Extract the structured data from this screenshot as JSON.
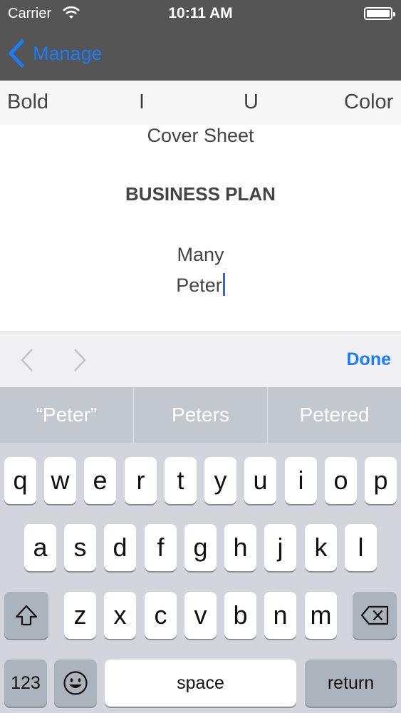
{
  "status_bar": {
    "carrier": "Carrier",
    "time": "10:11 AM"
  },
  "nav": {
    "back_label": "Manage"
  },
  "format_toolbar": {
    "bold": "Bold",
    "italic": "I",
    "underline": "U",
    "color": "Color"
  },
  "document": {
    "line1": "Cover Sheet",
    "line2": "BUSINESS PLAN",
    "line3": "Many",
    "line4": "Peter"
  },
  "accessory": {
    "done_label": "Done"
  },
  "suggestions": [
    "“Peter”",
    "Peters",
    "Petered"
  ],
  "keyboard": {
    "row1": [
      "q",
      "w",
      "e",
      "r",
      "t",
      "y",
      "u",
      "i",
      "o",
      "p"
    ],
    "row2": [
      "a",
      "s",
      "d",
      "f",
      "g",
      "h",
      "j",
      "k",
      "l"
    ],
    "row3": [
      "z",
      "x",
      "c",
      "v",
      "b",
      "n",
      "m"
    ],
    "numbers_label": "123",
    "space_label": "space",
    "return_label": "return"
  },
  "colors": {
    "accent": "#1b7cf5",
    "nav_bg": "#555555",
    "caret": "#3e5fd6"
  }
}
